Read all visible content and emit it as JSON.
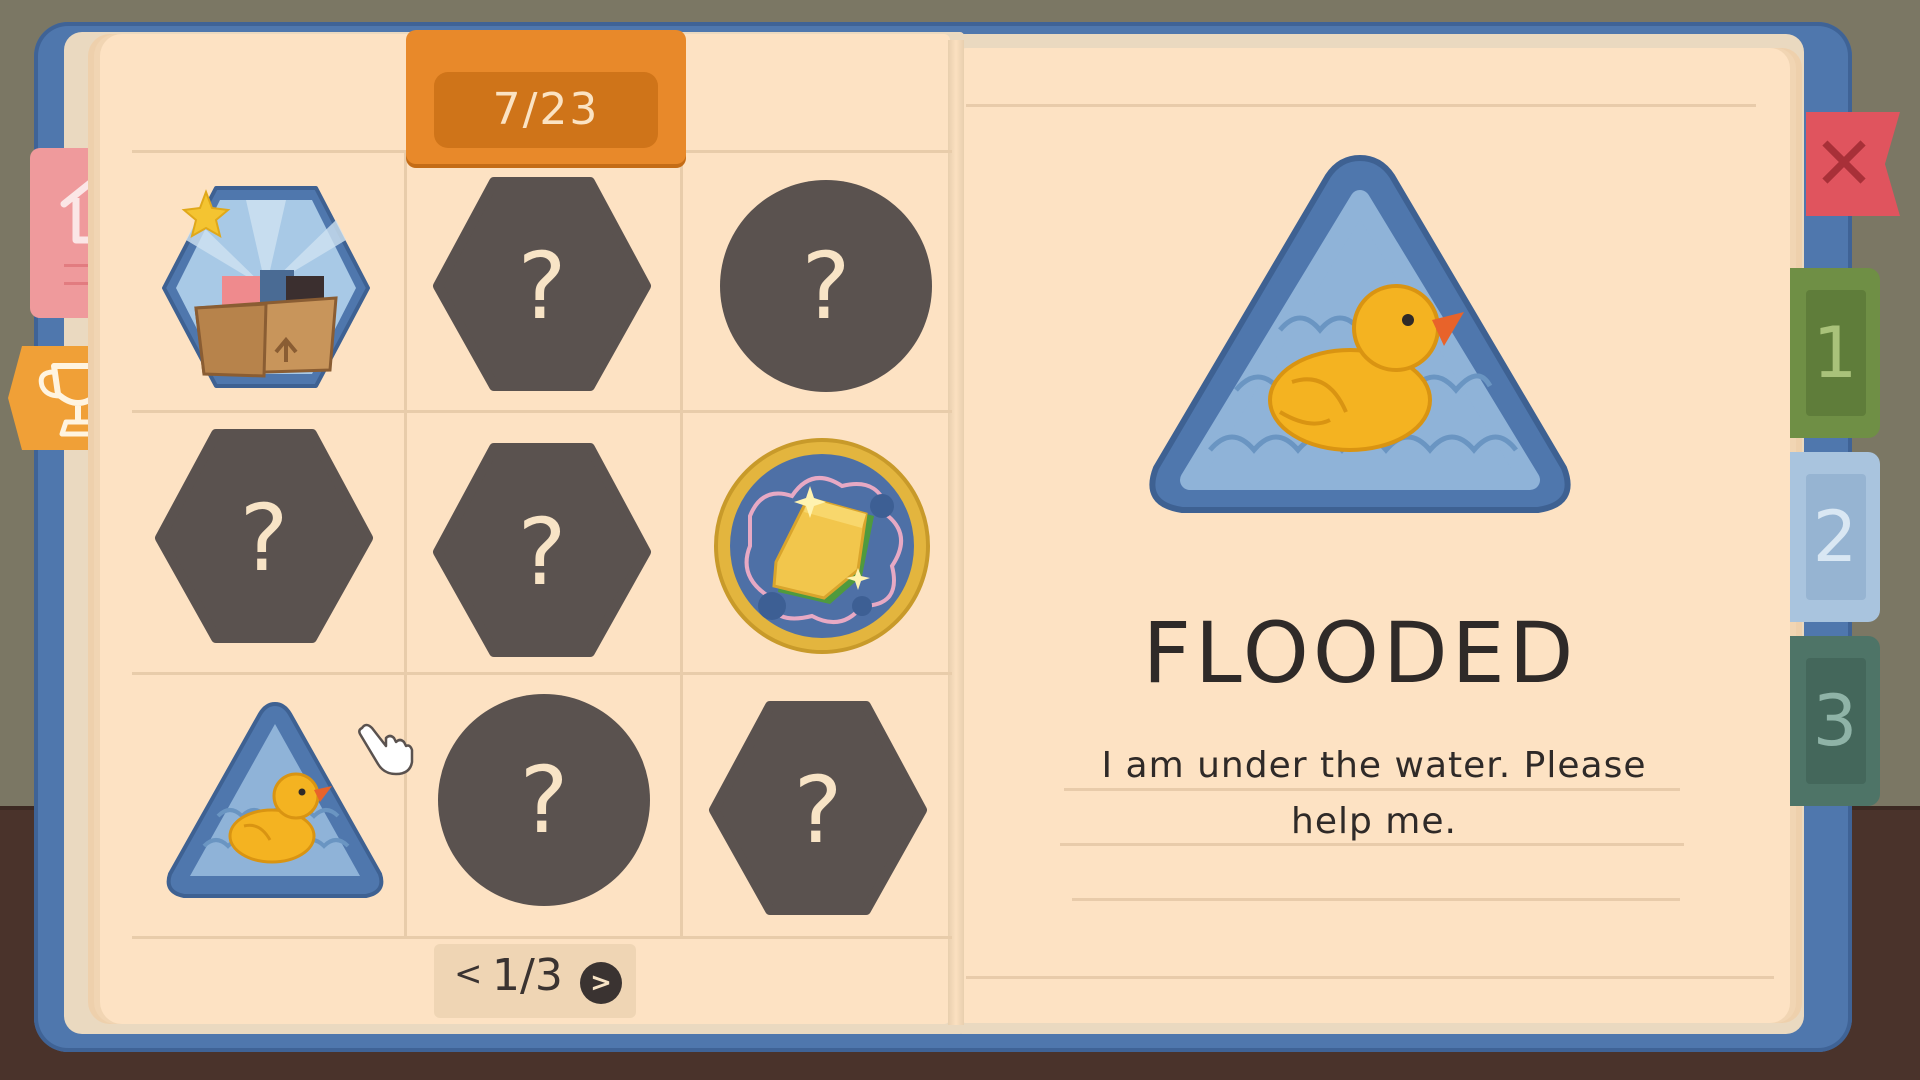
{
  "progress": {
    "counter": "7/23"
  },
  "pager": {
    "prev": "<",
    "page": "1/3",
    "next": ">"
  },
  "side_tabs": {
    "home_icon": "house-icon",
    "trophy_icon": "trophy-icon",
    "close_icon": "close-icon",
    "chapters": [
      "1",
      "2",
      "3"
    ]
  },
  "badges": [
    {
      "slot": 1,
      "status": "unlocked",
      "shape": "hexagon",
      "art": "cardboard-box-with-star",
      "favorite": true
    },
    {
      "slot": 2,
      "status": "locked",
      "shape": "hexagon",
      "label": "?"
    },
    {
      "slot": 3,
      "status": "locked",
      "shape": "circle",
      "label": "?"
    },
    {
      "slot": 4,
      "status": "locked",
      "shape": "hexagon",
      "label": "?"
    },
    {
      "slot": 5,
      "status": "locked",
      "shape": "hexagon",
      "label": "?"
    },
    {
      "slot": 6,
      "status": "unlocked",
      "shape": "circle",
      "art": "sandwich"
    },
    {
      "slot": 7,
      "status": "unlocked",
      "shape": "triangle",
      "art": "rubber-duck",
      "selected": true
    },
    {
      "slot": 8,
      "status": "locked",
      "shape": "circle",
      "label": "?"
    },
    {
      "slot": 9,
      "status": "locked",
      "shape": "hexagon",
      "label": "?"
    }
  ],
  "detail": {
    "title": "FLOODED",
    "description": "I am under the water. Please help me."
  },
  "colors": {
    "page": "#fde2c3",
    "cover": "#4f77ad",
    "locked_badge": "#5a524f",
    "counter_tab": "#e8892a",
    "close_tab": "#e0545e",
    "chapter1": "#6f8f45",
    "chapter2": "#a9c4de",
    "chapter3": "#4e7467"
  }
}
